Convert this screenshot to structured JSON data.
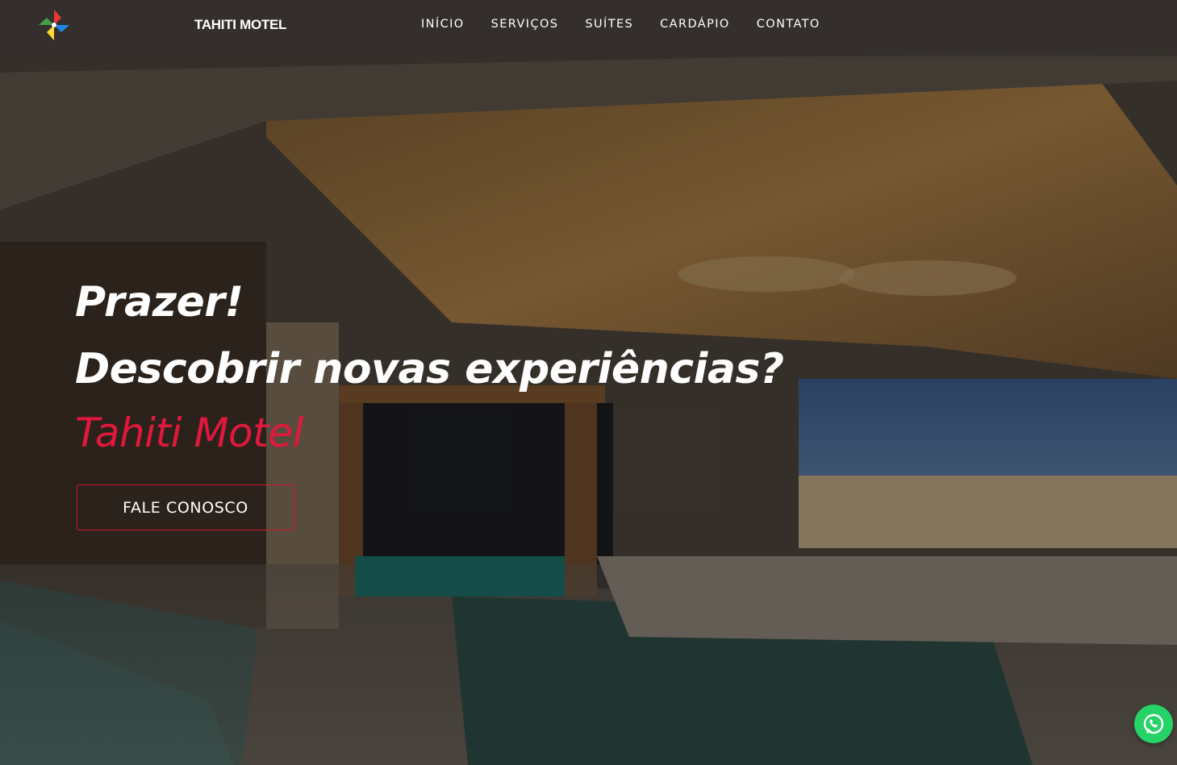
{
  "brand": {
    "name": "TAHITI MOTEL",
    "logo_icon": "pinwheel-logo-icon"
  },
  "nav": {
    "items": [
      {
        "label": "INÍCIO"
      },
      {
        "label": "SERVIÇOS"
      },
      {
        "label": "SUÍTES"
      },
      {
        "label": "CARDÁPIO"
      },
      {
        "label": "CONTATO"
      }
    ]
  },
  "hero": {
    "line1": "Prazer!",
    "line2": "Descobrir novas experiências?",
    "line3": "Tahiti Motel",
    "accent_color": "#e0183c",
    "cta_label": "FALE CONOSCO",
    "background_icon": "suite-room-photo"
  },
  "floating": {
    "whatsapp_icon": "whatsapp-icon",
    "color": "#25d366"
  }
}
